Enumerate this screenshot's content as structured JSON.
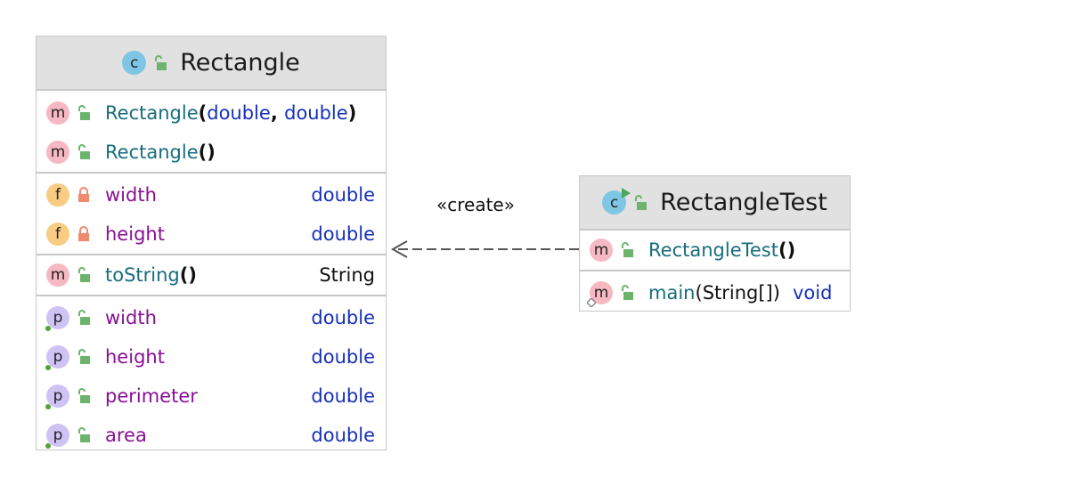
{
  "relation": {
    "label": "«create»"
  },
  "rectangle": {
    "title": "Rectangle",
    "constructors": [
      {
        "name": "Rectangle",
        "open": "(",
        "p1": "double",
        "sep": ", ",
        "p2": "double",
        "close": ")"
      },
      {
        "name": "Rectangle",
        "parens": "()"
      }
    ],
    "fields": [
      {
        "name": "width",
        "type": "double"
      },
      {
        "name": "height",
        "type": "double"
      }
    ],
    "methods": [
      {
        "name": "toString",
        "parens": "()",
        "type": "String"
      }
    ],
    "properties": [
      {
        "name": "width",
        "type": "double"
      },
      {
        "name": "height",
        "type": "double"
      },
      {
        "name": "perimeter",
        "type": "double"
      },
      {
        "name": "area",
        "type": "double"
      }
    ]
  },
  "rectangle_test": {
    "title": "RectangleTest",
    "constructor": {
      "name": "RectangleTest",
      "parens": "()"
    },
    "main": {
      "name": "main",
      "open": "(",
      "param": "String[]",
      "close": ")",
      "ret": "void"
    }
  },
  "badges": {
    "class": "c",
    "method": "m",
    "field": "f",
    "property": "p"
  }
}
